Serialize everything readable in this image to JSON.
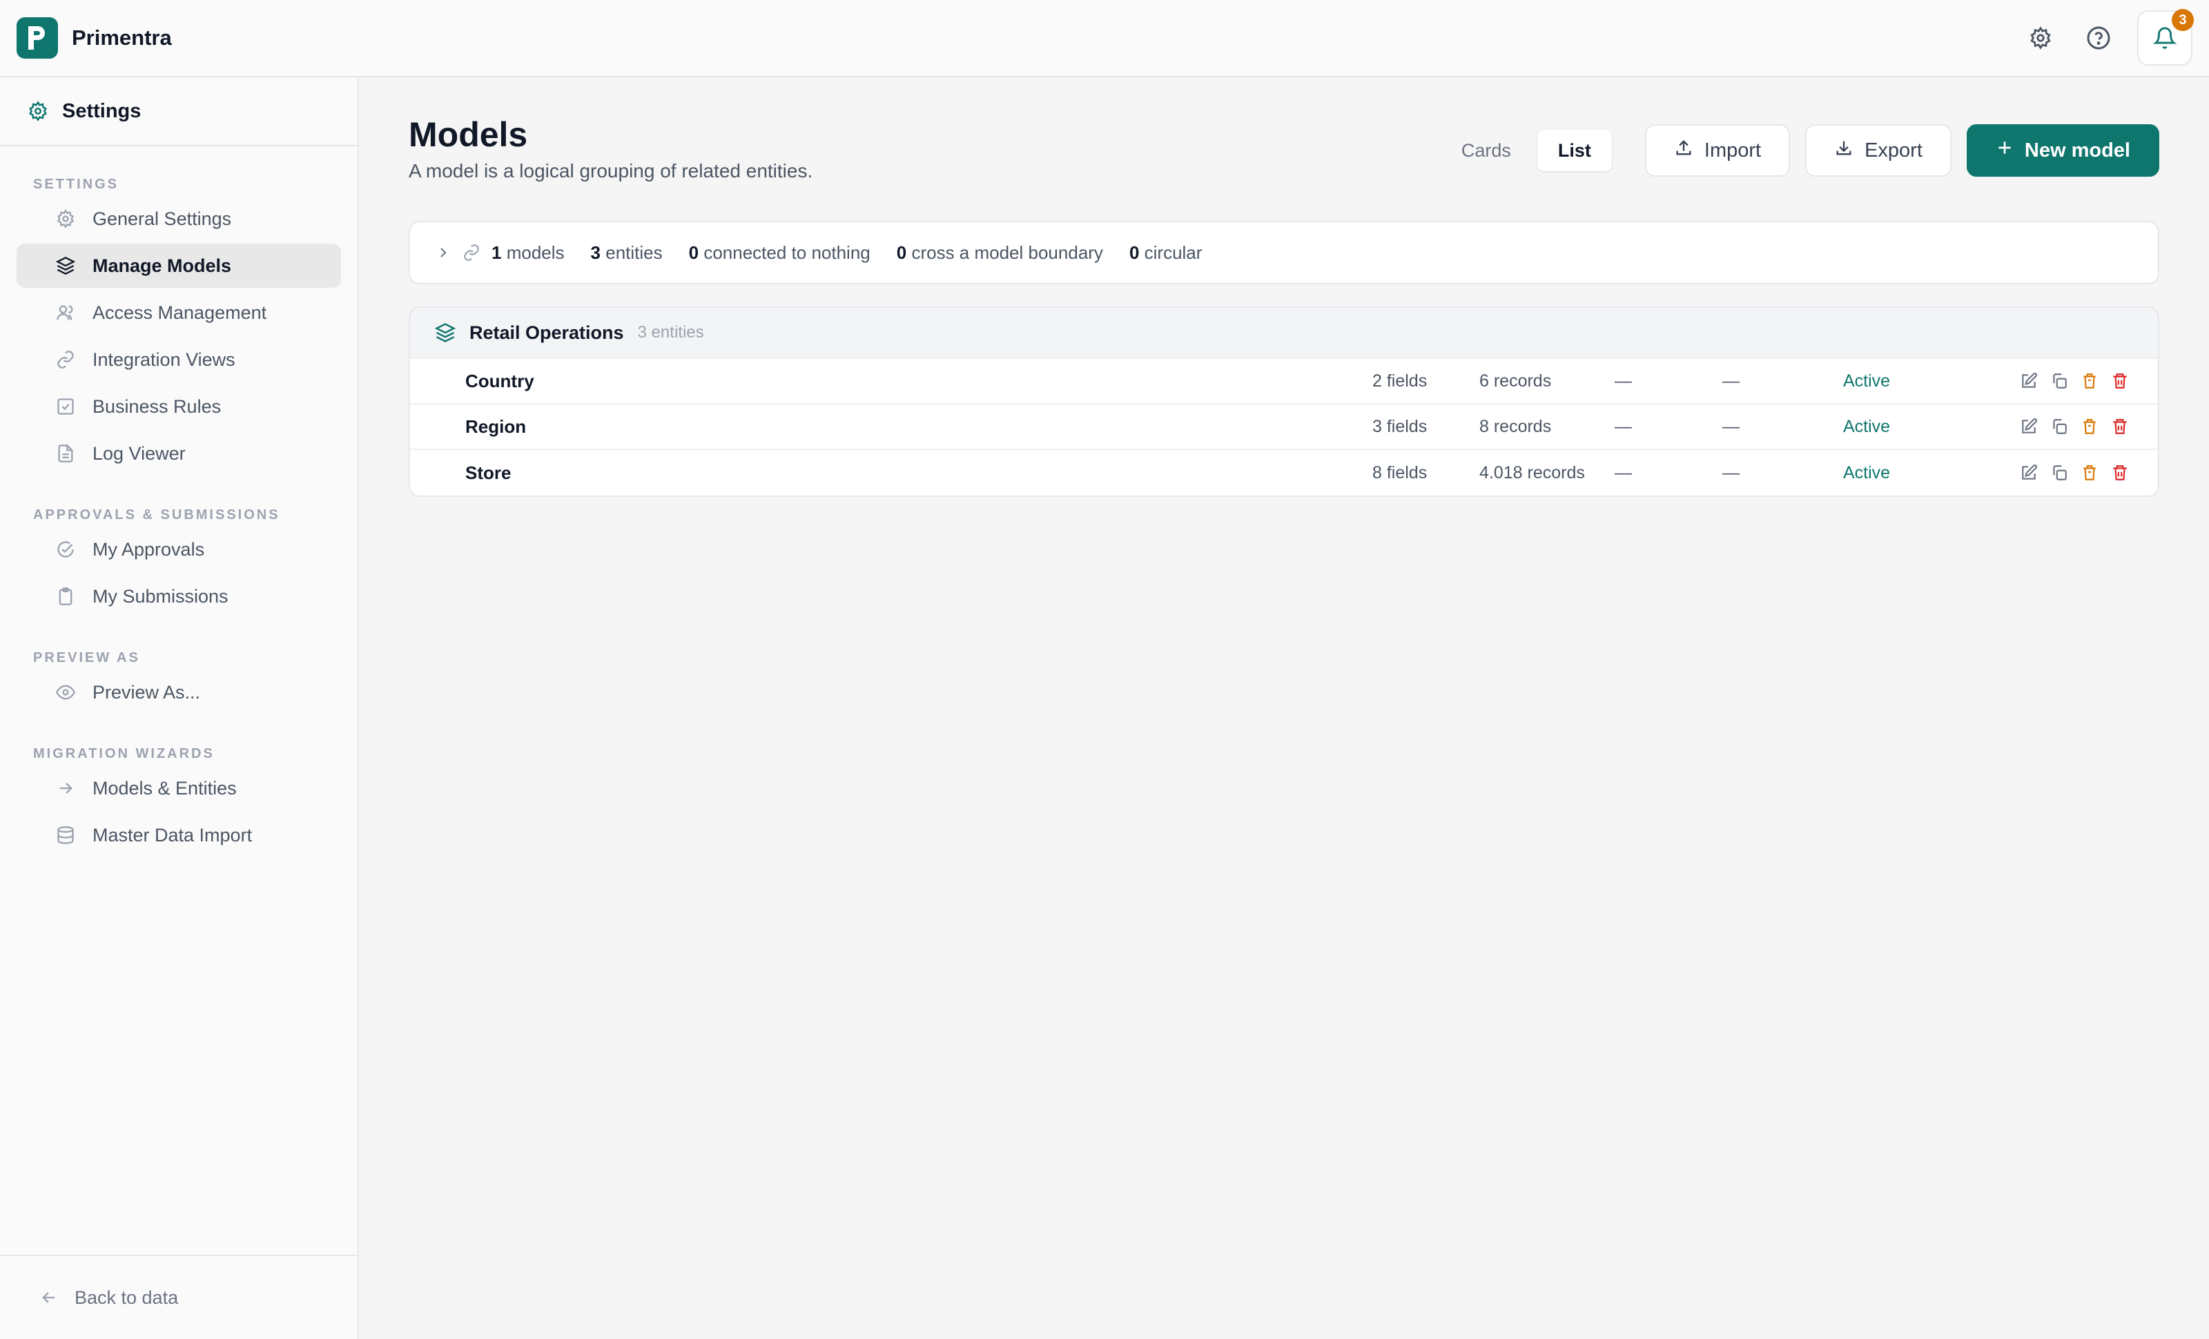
{
  "app": {
    "name": "Primentra"
  },
  "topbar": {
    "notifications_count": "3"
  },
  "sidebar": {
    "title": "Settings",
    "sections": [
      {
        "label": "SETTINGS",
        "items": [
          {
            "label": "General Settings",
            "icon": "gear-icon"
          },
          {
            "label": "Manage Models",
            "icon": "layers-icon",
            "active": true
          },
          {
            "label": "Access Management",
            "icon": "users-icon"
          },
          {
            "label": "Integration Views",
            "icon": "link-icon"
          },
          {
            "label": "Business Rules",
            "icon": "checkbox-icon"
          },
          {
            "label": "Log Viewer",
            "icon": "file-icon"
          }
        ]
      },
      {
        "label": "APPROVALS & SUBMISSIONS",
        "items": [
          {
            "label": "My Approvals",
            "icon": "check-circle-icon"
          },
          {
            "label": "My Submissions",
            "icon": "clipboard-icon"
          }
        ]
      },
      {
        "label": "PREVIEW AS",
        "items": [
          {
            "label": "Preview As...",
            "icon": "eye-icon"
          }
        ]
      },
      {
        "label": "MIGRATION WIZARDS",
        "items": [
          {
            "label": "Models & Entities",
            "icon": "arrow-right-icon"
          },
          {
            "label": "Master Data Import",
            "icon": "database-icon"
          }
        ]
      }
    ],
    "footer": "Back to data"
  },
  "page": {
    "title": "Models",
    "subtitle": "A model is a logical grouping of related entities.",
    "view_toggle": {
      "cards": "Cards",
      "list": "List",
      "selected": "List"
    },
    "import_label": "Import",
    "export_label": "Export",
    "new_label": "New model"
  },
  "stats": {
    "models_value": "1",
    "models_label": "models",
    "entities_value": "3",
    "entities_label": "entities",
    "nothing_value": "0",
    "nothing_label": "connected to nothing",
    "boundary_value": "0",
    "boundary_label": "cross a model boundary",
    "circular_value": "0",
    "circular_label": "circular"
  },
  "model_group": {
    "name": "Retail Operations",
    "count": "3 entities",
    "rows": [
      {
        "name": "Country",
        "fields": "2 fields",
        "records": "6 records",
        "col3": "—",
        "col4": "—",
        "status": "Active"
      },
      {
        "name": "Region",
        "fields": "3 fields",
        "records": "8 records",
        "col3": "—",
        "col4": "—",
        "status": "Active"
      },
      {
        "name": "Store",
        "fields": "8 fields",
        "records": "4.018 records",
        "col3": "—",
        "col4": "—",
        "status": "Active"
      }
    ]
  },
  "colors": {
    "accent": "#0f766e",
    "badge": "#d97706",
    "archive": "#d97706",
    "delete": "#dc2626"
  }
}
